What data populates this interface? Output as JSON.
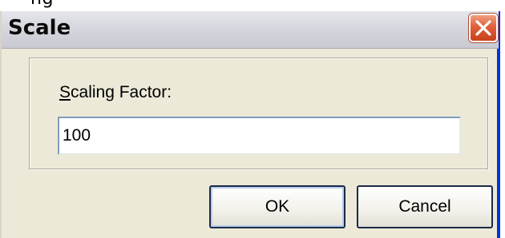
{
  "background_caption": "ng",
  "window": {
    "title": "Scale"
  },
  "form": {
    "label_mnemonic": "S",
    "label_rest": "caling Factor:",
    "value": "100"
  },
  "buttons": {
    "ok": "OK",
    "cancel": "Cancel"
  },
  "colors": {
    "window_bg": "#ece9d8",
    "close_button": "#e0603a",
    "input_border": "#7f9db9"
  }
}
